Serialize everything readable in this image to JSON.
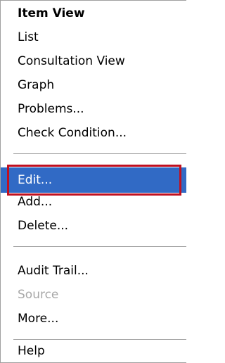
{
  "menu": {
    "items": [
      {
        "label": "Item View"
      },
      {
        "label": "List"
      },
      {
        "label": "Consultation View"
      },
      {
        "label": "Graph"
      },
      {
        "label": "Problems..."
      },
      {
        "label": "Check Condition..."
      },
      {
        "label": "Edit..."
      },
      {
        "label": "Add..."
      },
      {
        "label": "Delete..."
      },
      {
        "label": "Audit Trail..."
      },
      {
        "label": "Source"
      },
      {
        "label": "More..."
      },
      {
        "label": "Help"
      }
    ],
    "selected_item": "Edit...",
    "disabled_item": "Source",
    "default_item": "Item View"
  },
  "colors": {
    "selection_background": "#316ac5",
    "selection_text": "#ffffff",
    "disabled_text": "#a8a8a8",
    "highlight_outline": "#c01020",
    "separator": "#a0a0a0"
  }
}
